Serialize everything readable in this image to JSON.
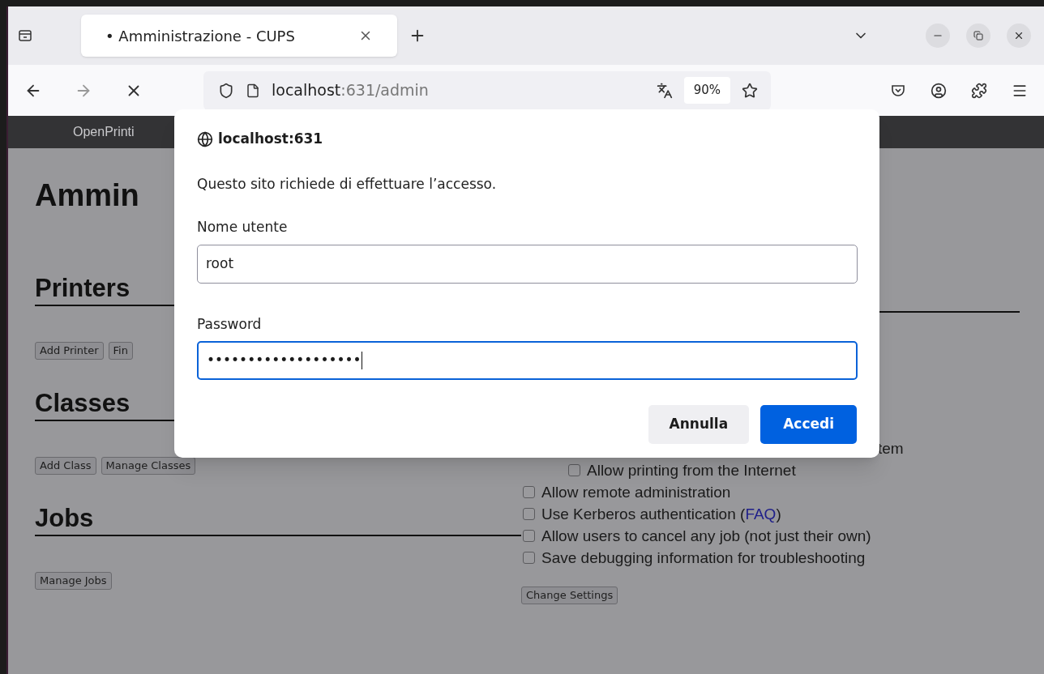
{
  "browser": {
    "tab": {
      "title": "• Amministrazione - CUPS",
      "selected": true
    },
    "address": {
      "host": "localhost",
      "path": ":631/admin"
    },
    "zoom": "90%"
  },
  "page": {
    "header": "OpenPrinti",
    "title": "Ammin",
    "sections": [
      {
        "heading": "Printers",
        "buttons": [
          "Add Printer",
          "Fin"
        ]
      },
      {
        "heading": "Classes",
        "buttons": [
          "Add Class",
          "Manage Classes"
        ]
      },
      {
        "heading": "Jobs",
        "buttons": [
          "Manage Jobs"
        ]
      }
    ],
    "settings": [
      {
        "label": "tem",
        "children": [
          {
            "label": "Allow printing from the Internet",
            "checked": false
          }
        ]
      },
      {
        "label": "Allow remote administration",
        "checked": false
      },
      {
        "label": "Use Kerberos authentication (",
        "link": "FAQ",
        "label_end": ")",
        "checked": false
      },
      {
        "label": "Allow users to cancel any job (not just their own)",
        "checked": false
      },
      {
        "label": "Save debugging information for troubleshooting",
        "checked": false
      }
    ],
    "settings_button": "Change Settings"
  },
  "dialog": {
    "origin": "localhost:631",
    "message": "Questo sito richiede di effettuare l’accesso.",
    "fields": [
      {
        "label": "Nome utente",
        "value": "root",
        "focused": false
      },
      {
        "label": "Password",
        "value": "•••••••••••••••••••",
        "focused": true
      }
    ],
    "buttons": [
      {
        "label": "Annulla",
        "kind": "secondary"
      },
      {
        "label": "Accedi",
        "kind": "primary"
      }
    ]
  }
}
